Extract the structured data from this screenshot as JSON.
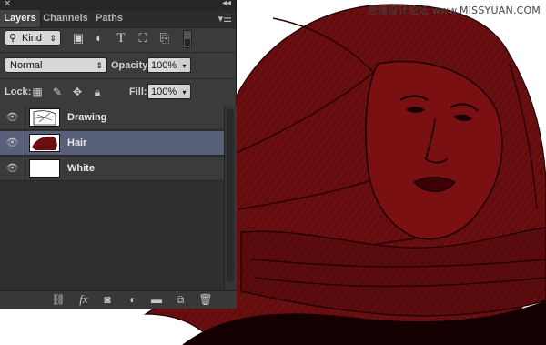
{
  "watermark": "思缘设计论坛 www.MISSYUAN.COM",
  "panel": {
    "tabs": [
      {
        "label": "Layers",
        "active": true
      },
      {
        "label": "Channels",
        "active": false
      },
      {
        "label": "Paths",
        "active": false
      }
    ],
    "filter": {
      "kind_label": "Kind",
      "icons": [
        "pixel-layer-filter-icon",
        "adjustment-layer-filter-icon",
        "type-layer-filter-icon",
        "shape-layer-filter-icon",
        "smart-object-filter-icon"
      ]
    },
    "blend_mode": "Normal",
    "opacity_label": "Opacity:",
    "opacity_value": "100%",
    "lock_label": "Lock:",
    "fill_label": "Fill:",
    "fill_value": "100%",
    "layers": [
      {
        "name": "Drawing",
        "visible": true,
        "selected": false
      },
      {
        "name": "Hair",
        "visible": true,
        "selected": true
      },
      {
        "name": "White",
        "visible": true,
        "selected": false
      }
    ],
    "footer_icons": [
      "link-layers-icon",
      "fx-icon",
      "add-mask-icon",
      "adjustment-layer-icon",
      "new-group-icon",
      "new-layer-icon",
      "trash-icon"
    ]
  },
  "colors": {
    "hair_red": "#6b0e10",
    "panel_bg": "#3b3b3b",
    "selected_row": "#59607a"
  }
}
